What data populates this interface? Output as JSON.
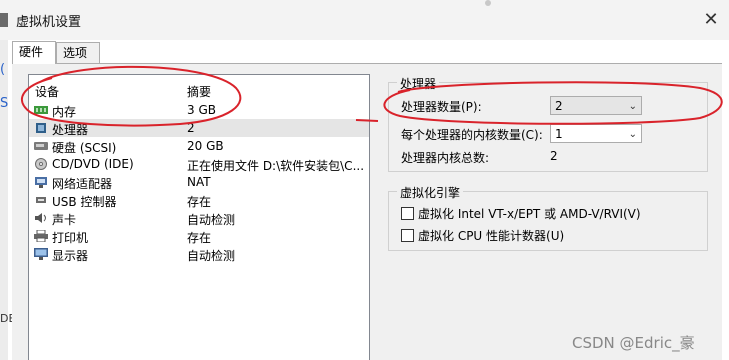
{
  "window": {
    "title": "虚拟机设置",
    "close_label": "✕"
  },
  "tabs": [
    {
      "label": "硬件",
      "active": true
    },
    {
      "label": "选项",
      "active": false
    }
  ],
  "left_edge_glyphs": [
    "(",
    "S",
    "DE"
  ],
  "device_list": {
    "header_device": "设备",
    "header_summary": "摘要",
    "rows": [
      {
        "name": "内存",
        "summary": "3 GB",
        "icon": "memory-icon",
        "selected": false
      },
      {
        "name": "处理器",
        "summary": "2",
        "icon": "processor-icon",
        "selected": true
      },
      {
        "name": "硬盘 (SCSI)",
        "summary": "20 GB",
        "icon": "harddisk-icon",
        "selected": false
      },
      {
        "name": "CD/DVD (IDE)",
        "summary": "正在使用文件 D:\\软件安装包\\C...",
        "icon": "cd-dvd-icon",
        "selected": false
      },
      {
        "name": "网络适配器",
        "summary": "NAT",
        "icon": "network-adapter-icon",
        "selected": false
      },
      {
        "name": "USB 控制器",
        "summary": "存在",
        "icon": "usb-icon",
        "selected": false
      },
      {
        "name": "声卡",
        "summary": "自动检测",
        "icon": "sound-icon",
        "selected": false
      },
      {
        "name": "打印机",
        "summary": "存在",
        "icon": "printer-icon",
        "selected": false
      },
      {
        "name": "显示器",
        "summary": "自动检测",
        "icon": "display-icon",
        "selected": false
      }
    ]
  },
  "processor": {
    "group_title": "处理器",
    "count_label": "处理器数量(P):",
    "count_value": "2",
    "cores_label": "每个处理器的内核数量(C):",
    "cores_value": "1",
    "total_label": "处理器内核总数:",
    "total_value": "2"
  },
  "virtualization": {
    "group_title": "虚拟化引擎",
    "option1": "虚拟化 Intel VT-x/EPT 或 AMD-V/RVI(V)",
    "option2": "虚拟化 CPU 性能计数器(U)"
  },
  "watermark": "CSDN @Edric_豪",
  "colors": {
    "annotation": "#d9232b",
    "selection": "#e5e5e5"
  }
}
